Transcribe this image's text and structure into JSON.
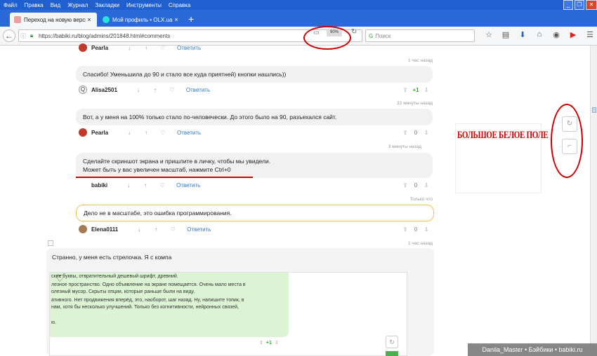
{
  "menu": [
    "Файл",
    "Правка",
    "Вид",
    "Журнал",
    "Закладки",
    "Инструменты",
    "Справка"
  ],
  "window_buttons": [
    "_",
    "❐",
    "✕"
  ],
  "tabs": [
    {
      "title": "Переход на новую версию /...",
      "close": "×"
    },
    {
      "title": "Мой профиль • OLX.ua",
      "close": "×"
    }
  ],
  "new_tab": "+",
  "nav": {
    "back": "←",
    "url": "https://babiki.ru/blog/admins/201848.html#comments",
    "zoom": "90%",
    "reload": "↻",
    "search_placeholder": "Поиск",
    "search_icon": "G"
  },
  "toolbar_icons": [
    "☆",
    "▤",
    "⬇",
    "⌂",
    "◉",
    "▶",
    "☰"
  ],
  "comments": [
    {
      "text": "",
      "user": "Pearla",
      "reply": "Ответить",
      "score": "",
      "time": "1 час назад"
    },
    {
      "text": "Спасибо! Уменьшила до 90 и стало все куда приятней) кнопки нашлись))",
      "user": "Alisa2501",
      "reply": "Ответить",
      "score": "+1",
      "time": "33 минуты назад"
    },
    {
      "text": "Вот, а у меня на 100% только стало по-человечески. До этого было на 90, разъехался сайт.",
      "user": "Pearla",
      "reply": "Ответить",
      "score": "0",
      "time": "3 минуты назад"
    },
    {
      "text1": "Сделайте скриншот экрана и пришлите в личку, чтобы мы увидели.",
      "text2": "Может быть у вас увеличен масштаб, нажмите Ctrl+0",
      "user": "babiki",
      "reply": "Ответить",
      "score": "0",
      "time": "Только что"
    },
    {
      "text": "Дело не в масштабе, это ошибка программирования.",
      "user": "Elena0111",
      "reply": "Ответить",
      "score": "0",
      "time": "1 час назад"
    }
  ],
  "big_post": {
    "text": "Странно, у меня есть стрелочка. Я с компа",
    "embedded_lines": [
      "ские буквы, отвратительный дешевый шрифт, древний.",
      "лезное пространство. Одно объявление на экране помещается. Очень мало места в",
      "олезный мусор. Скрыты опции, которые раньше были на виду.",
      "ативного. Нет продвижения вперёд, это, наоборот, шаг назад. Ну, напишите топик, в",
      "нам, хотя бы несколько улучшений. Только без когнитивности, нейронных связей,",
      "ю."
    ],
    "embedded_score": "+1"
  },
  "white_field_label": "БОЛЬШОЕ БЕЛОЕ ПОЛЕ",
  "watermark": "Danila_Master • Бэйбики • babiki.ru",
  "colors": {
    "menubar": "#1f5fd0",
    "accent_red": "#d00000",
    "vote_green": "#3aa33a",
    "reply_blue": "#2f78c4"
  }
}
